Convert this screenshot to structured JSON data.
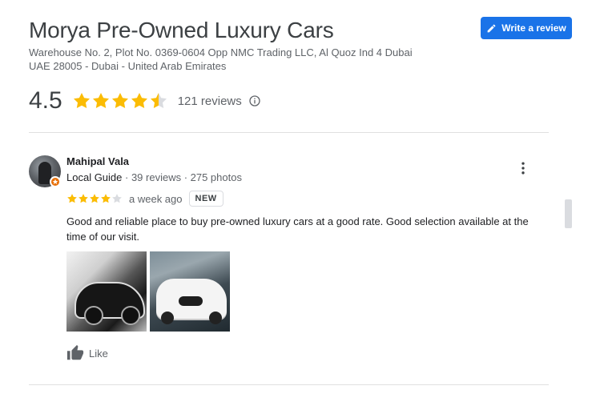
{
  "business": {
    "name": "Morya Pre-Owned Luxury Cars",
    "address_line1": "Warehouse No. 2, Plot No. 0369-0604 Opp NMC Trading LLC, Al Quoz Ind 4 Dubai",
    "address_line2": "UAE 28005 - Dubai - United Arab Emirates"
  },
  "write_review_label": "Write a review",
  "rating": {
    "value": "4.5",
    "stars": 4.5,
    "reviews_label": "121 reviews"
  },
  "review": {
    "author": "Mahipal Vala",
    "badge": "Local Guide",
    "meta": " · 39 reviews · 275 photos",
    "stars": 4,
    "when": "a week ago",
    "new_badge": "NEW",
    "text": "Good and reliable place to buy pre-owned luxury cars at a good rate. Good selection available at the time of our visit.",
    "like_label": "Like"
  },
  "colors": {
    "accent": "#1a73e8",
    "star": "#fbbc04",
    "star_empty": "#dadce0",
    "guide_badge": "#e8710a"
  },
  "icons": [
    "pencil-icon",
    "star-icon",
    "info-icon",
    "local-guide-icon",
    "more-vert-icon",
    "thumb-up-icon"
  ]
}
